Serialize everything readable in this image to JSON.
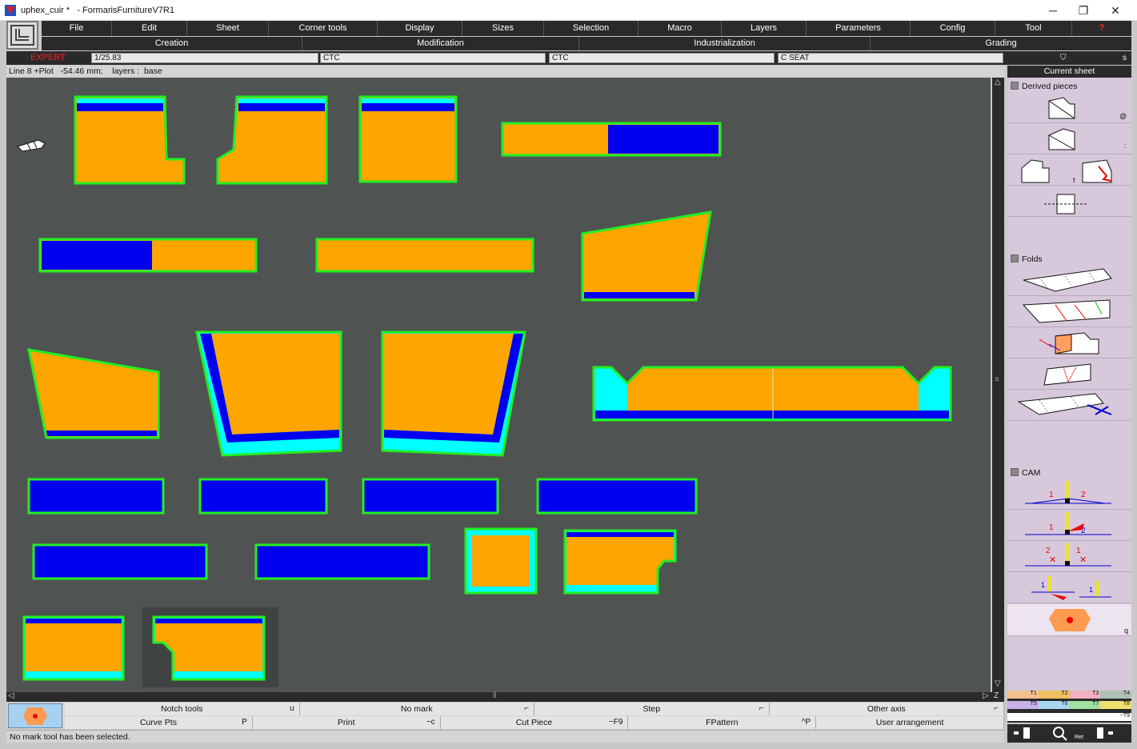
{
  "window": {
    "title": "uphex_cuir *   - FormarisFurnitureV7R1",
    "minimize": "─",
    "maximize": "❐",
    "close": "✕"
  },
  "menu": [
    "File",
    "Edit",
    "Sheet",
    "Corner tools",
    "Display",
    "Sizes",
    "Selection",
    "Macro",
    "Layers",
    "Parameters",
    "Config",
    "Tool"
  ],
  "categories": [
    "Creation",
    "Modification",
    "Industrialization",
    "Grading"
  ],
  "fields": {
    "mode": "EXPERT",
    "scale": "1/25.83",
    "f1": "CTC",
    "f2": "CTC",
    "f3": "C SEAT",
    "s": "s"
  },
  "status": {
    "line": "Line 8 +Plot   -54.46 mm;    layers :  base",
    "current_sheet": "Current sheet"
  },
  "panel": {
    "derived": "Derived pieces",
    "folds": "Folds",
    "cam": "CAM",
    "keys": [
      "@",
      ":",
      "t",
      "q"
    ],
    "cam_labels": [
      "1",
      "2",
      "1",
      "2",
      "2",
      "1",
      "1",
      "1"
    ]
  },
  "legend": {
    "row1": [
      "T1",
      "T2",
      "T3",
      "T4"
    ],
    "row2": [
      "T5",
      "T6",
      "T7",
      "T8"
    ],
    "row3": "~T9"
  },
  "bottom": {
    "row1": [
      {
        "label": "Notch tools",
        "key": "u"
      },
      {
        "label": "No mark",
        "key": "⌐"
      },
      {
        "label": "Step",
        "key": "⌐"
      },
      {
        "label": "Other axis",
        "key": "⌐"
      }
    ],
    "row2": [
      {
        "label": "Curve Pts",
        "key": "P"
      },
      {
        "label": "Print",
        "key": "~c"
      },
      {
        "label": "Cut Piece",
        "key": "~F9"
      },
      {
        "label": "FPattern",
        "key": "^P"
      },
      {
        "label": "User arrangement",
        "key": ""
      }
    ],
    "message": "No mark tool has been selected.",
    "zoom_label": "Ret"
  },
  "colors": {
    "piece_fill": "#ffa500",
    "piece_outline": "#22ee22",
    "band_blue": "#0000ee",
    "seam_cyan": "#00ffff",
    "canvas_bg": "#4f5452"
  }
}
